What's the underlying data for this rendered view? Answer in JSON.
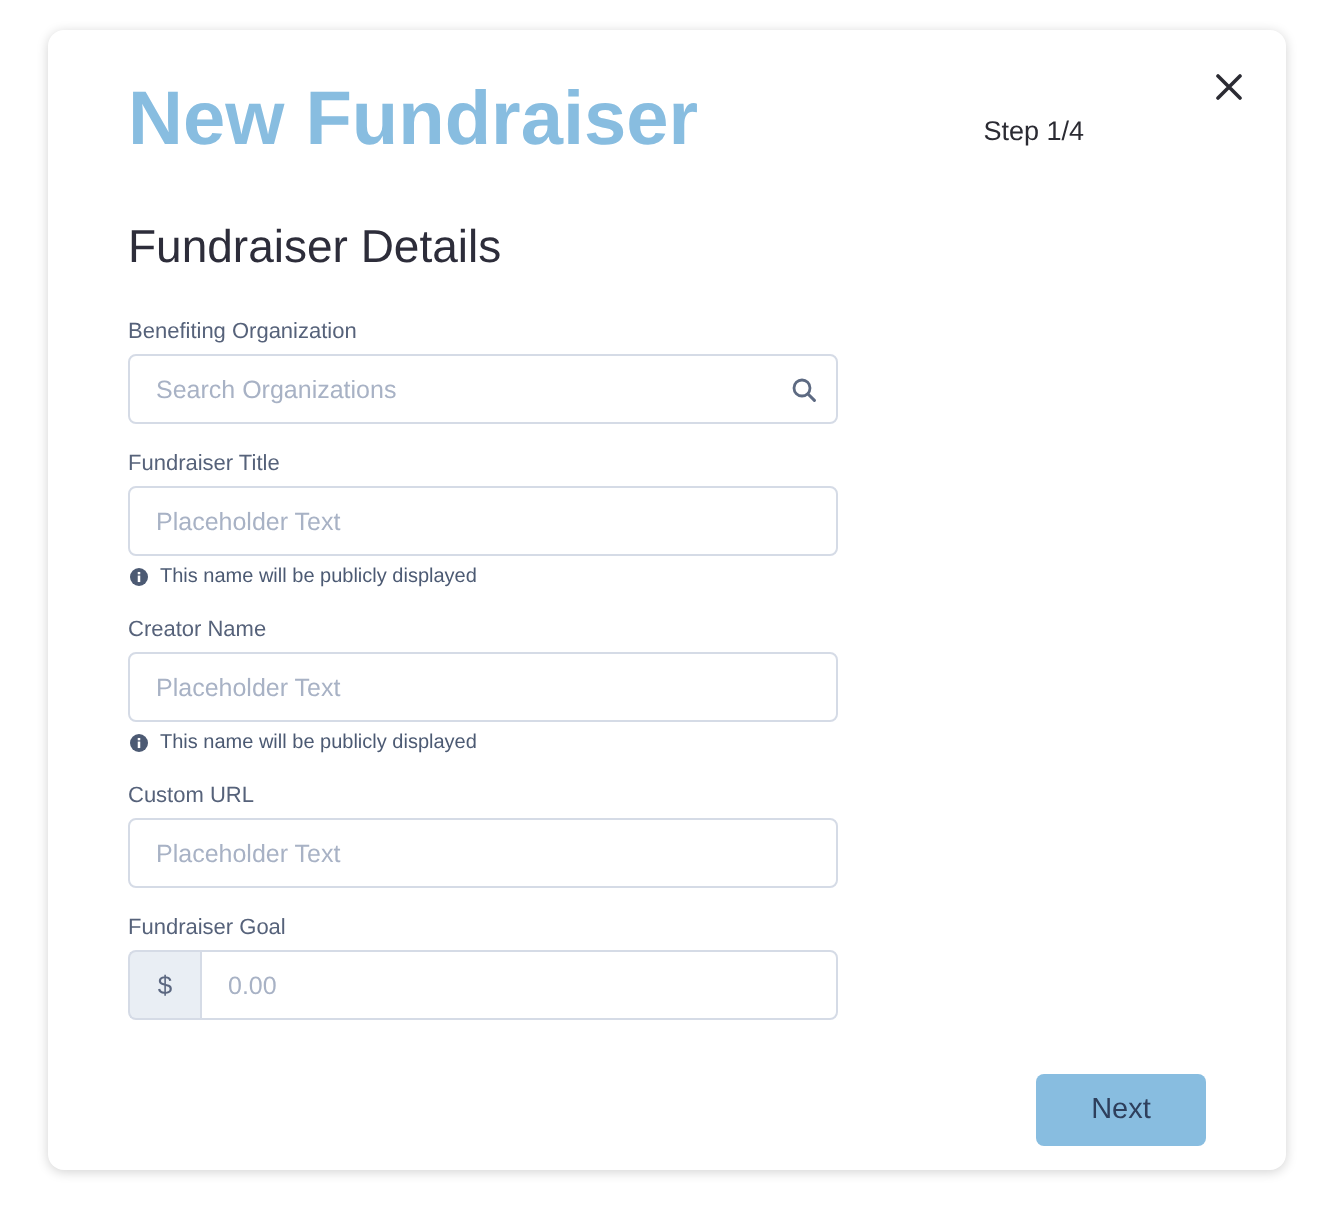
{
  "dialog": {
    "title": "New Fundraiser",
    "step": "Step 1/4"
  },
  "section": {
    "heading": "Fundraiser Details"
  },
  "fields": [
    {
      "kind": "search",
      "label": "Benefiting Organization",
      "placeholder": "Search Organizations"
    },
    {
      "kind": "text",
      "label": "Fundraiser Title",
      "placeholder": "Placeholder Text",
      "hint": "This name will be publicly displayed"
    },
    {
      "kind": "text",
      "label": "Creator Name",
      "placeholder": "Placeholder Text",
      "hint": "This name will be publicly displayed"
    },
    {
      "kind": "text",
      "label": "Custom URL",
      "placeholder": "Placeholder Text"
    },
    {
      "kind": "currency",
      "label": "Fundraiser Goal",
      "prefix": "$",
      "placeholder": "0.00"
    }
  ],
  "next_button": {
    "label": "Next"
  }
}
